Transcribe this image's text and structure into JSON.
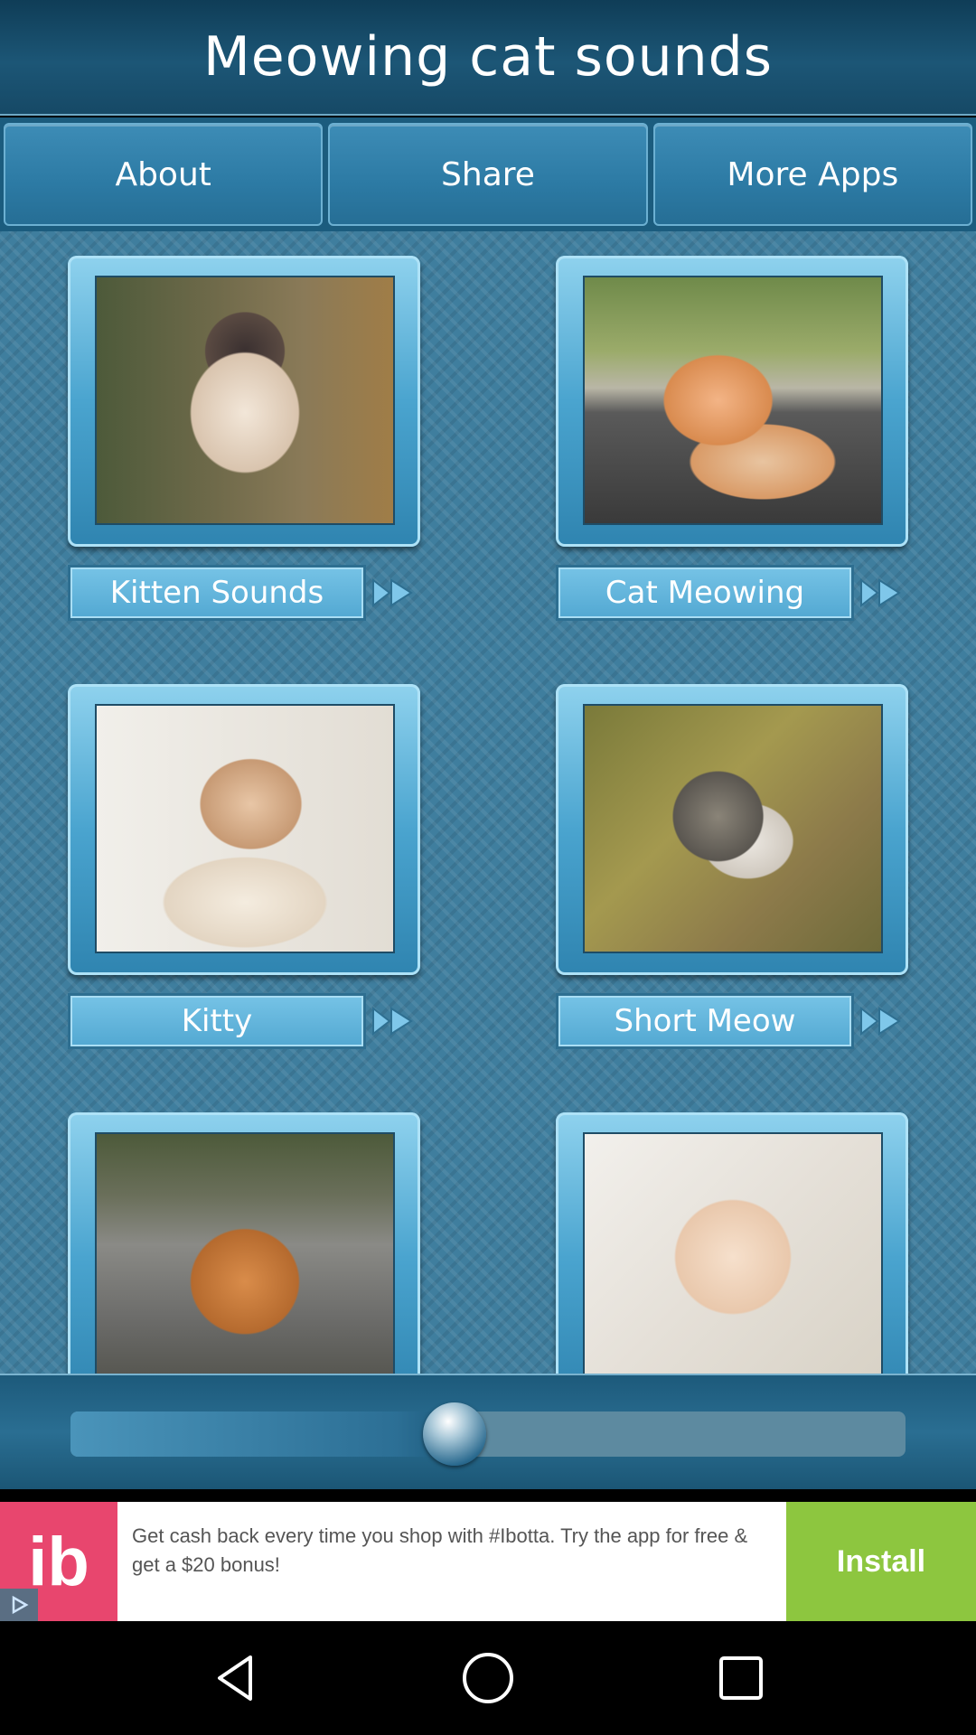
{
  "header": {
    "title": "Meowing cat sounds"
  },
  "menu": {
    "about": "About",
    "share": "Share",
    "more_apps": "More Apps"
  },
  "sounds": [
    {
      "label": "Kitten Sounds"
    },
    {
      "label": "Cat Meowing"
    },
    {
      "label": "Kitty"
    },
    {
      "label": "Short Meow"
    },
    {
      "label": ""
    },
    {
      "label": ""
    }
  ],
  "player": {
    "progress": 0.46
  },
  "ad": {
    "logo": "ib",
    "text": "Get cash back every time you shop with #Ibotta. Try the app for free & get a $20 bonus!",
    "install": "Install"
  },
  "colors": {
    "accent": "#2c7aa4",
    "ad_logo": "#e8466e",
    "install": "#8dc63f"
  },
  "icons": [
    "arrow-right-icon",
    "play-icon",
    "back-icon",
    "home-icon",
    "recents-icon"
  ]
}
